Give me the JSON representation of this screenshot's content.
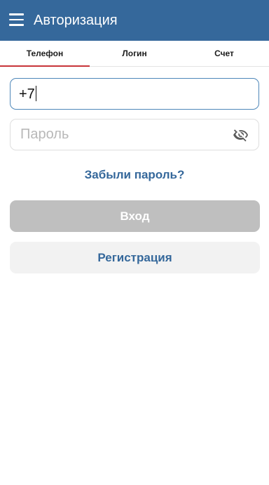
{
  "appbar": {
    "title": "Авторизация",
    "menu_icon": "hamburger-menu-icon",
    "background": "#35689b"
  },
  "tabs": [
    {
      "label": "Телефон",
      "active": true
    },
    {
      "label": "Логин",
      "active": false
    },
    {
      "label": "Счет",
      "active": false
    }
  ],
  "tab_indicator_color": "#c8353a",
  "form": {
    "phone_value": "+7",
    "password_placeholder": "Пароль",
    "password_toggle_icon": "eye-off-icon"
  },
  "links": {
    "forgot_password": "Забыли пароль?"
  },
  "buttons": {
    "login": "Вход",
    "register": "Регистрация"
  }
}
